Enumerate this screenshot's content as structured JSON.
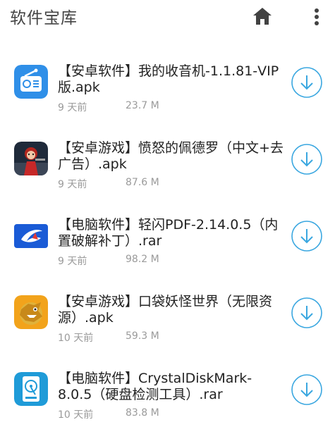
{
  "header": {
    "title": "软件宝库",
    "home_icon": "home-icon",
    "more_icon": "more-vert-icon"
  },
  "colors": {
    "accent": "#3aa7e0",
    "meta_text": "#9a9a9a"
  },
  "items": [
    {
      "title": "【安卓软件】我的收音机-1.1.81-VIP版.apk",
      "time": "9 天前",
      "size": "23.7 M",
      "icon": "radio-app-icon"
    },
    {
      "title": "【安卓游戏】愤怒的佩德罗（中文+去广告）.apk",
      "time": "9 天前",
      "size": "87.6 M",
      "icon": "game-pedro-icon"
    },
    {
      "title": "【电脑软件】轻闪PDF-2.14.0.5（内置破解补丁）.rar",
      "time": "9 天前",
      "size": "98.2 M",
      "icon": "pdf-app-icon"
    },
    {
      "title": "【安卓游戏】口袋妖怪世界（无限资源）.apk",
      "time": "10 天前",
      "size": "59.3 M",
      "icon": "game-monster-icon"
    },
    {
      "title": "【电脑软件】CrystalDiskMark-8.0.5（硬盘检测工具）.rar",
      "time": "10 天前",
      "size": "83.8 M",
      "icon": "disk-app-icon"
    }
  ]
}
